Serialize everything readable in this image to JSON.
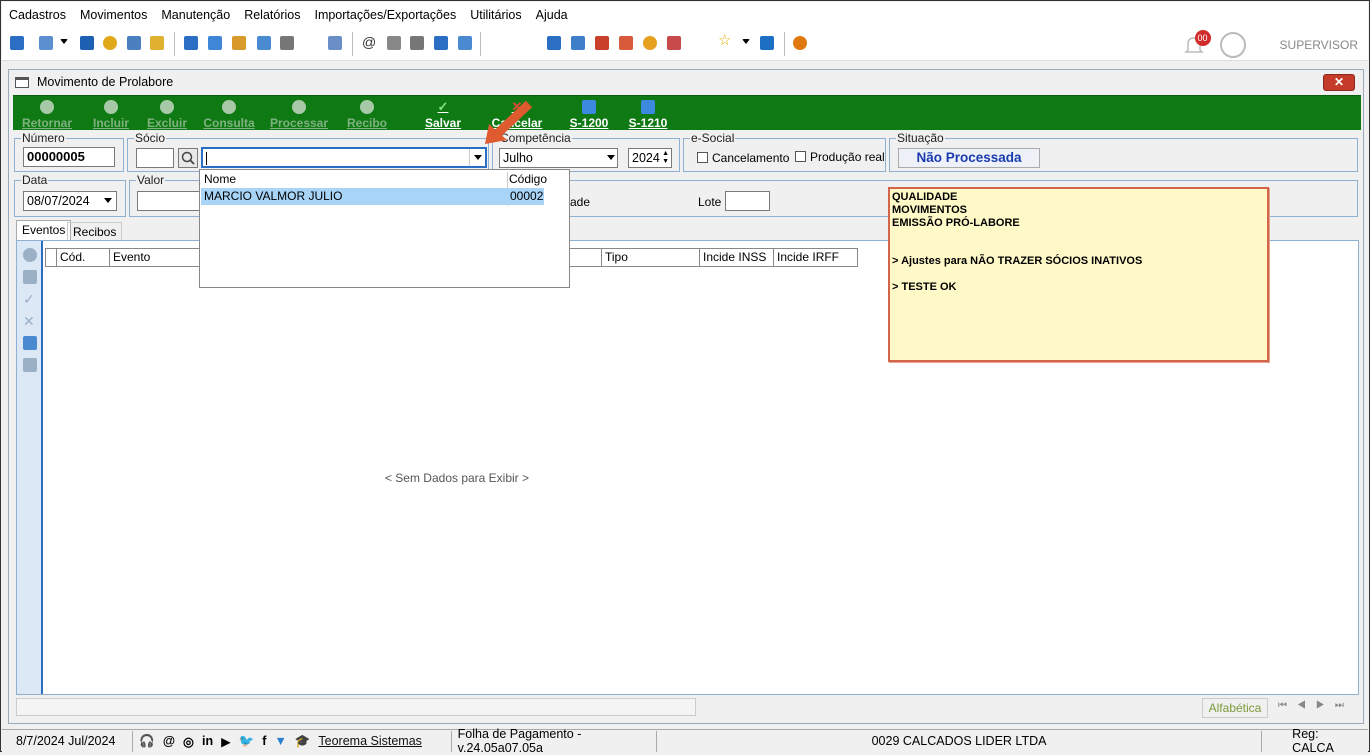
{
  "menu": [
    "Cadastros",
    "Movimentos",
    "Manutenção",
    "Relatórios",
    "Importações/Exportações",
    "Utilitários",
    "Ajuda"
  ],
  "toolbar": {
    "notify_count": "00",
    "user": "SUPERVISOR"
  },
  "window": {
    "title": "Movimento de Prolabore",
    "close": "✕"
  },
  "actions": [
    {
      "label": "Retornar",
      "enabled": false
    },
    {
      "label": "Incluir",
      "enabled": false
    },
    {
      "label": "Excluir",
      "enabled": false
    },
    {
      "label": "Consulta",
      "enabled": false
    },
    {
      "label": "Processar",
      "enabled": false
    },
    {
      "label": "Recibo",
      "enabled": false
    },
    {
      "label": "Salvar",
      "enabled": true
    },
    {
      "label": "Cancelar",
      "enabled": true
    },
    {
      "label": "S-1200",
      "enabled": true
    },
    {
      "label": "S-1210",
      "enabled": true
    }
  ],
  "form": {
    "numero_label": "Número",
    "numero": "00000005",
    "socio_label": "Sócio",
    "socio_code": "",
    "socio_name": "",
    "competencia_label": "Competência",
    "mes": "Julho",
    "ano": "2024",
    "esocial_label": "e-Social",
    "cancelamento": "Cancelamento",
    "producao": "Produção real",
    "situacao_label": "Situação",
    "situacao": "Não Processada",
    "data_label": "Data",
    "data": "08/07/2024",
    "valor_label": "Valor",
    "valor": "",
    "ade_label": "ade",
    "lote_label": "Lote",
    "lote": ""
  },
  "dropdown": {
    "col_nome": "Nome",
    "col_codigo": "Código",
    "rows": [
      {
        "nome": "MARCIO VALMOR JULIO",
        "codigo": "00002"
      }
    ]
  },
  "note": [
    "QUALIDADE",
    "MOVIMENTOS",
    "EMISSÃO PRÓ-LABORE",
    "",
    "> Ajustes para NÃO TRAZER SÓCIOS INATIVOS",
    "",
    "> TESTE OK"
  ],
  "tabs": [
    "Eventos",
    "Recibos"
  ],
  "grid": {
    "columns": [
      "Cód.",
      "Evento",
      "Tipo",
      "Incide INSS",
      "Incide IRFF"
    ],
    "empty": "< Sem Dados para Exibir >"
  },
  "bottom": {
    "order": "Alfabética"
  },
  "status": {
    "date": "8/7/2024 Jul/2024",
    "company_link": "Teorema Sistemas",
    "app": "Folha de Pagamento - v.24.05a07.05a",
    "firm": "0029 CALCADOS LIDER LTDA",
    "reg": "Reg: CALCA"
  },
  "colors": {
    "action_bg": "#0f7a14",
    "note_bg": "#fff9c8",
    "note_border": "#d3644a",
    "situacao_text": "#1a3bb0"
  }
}
